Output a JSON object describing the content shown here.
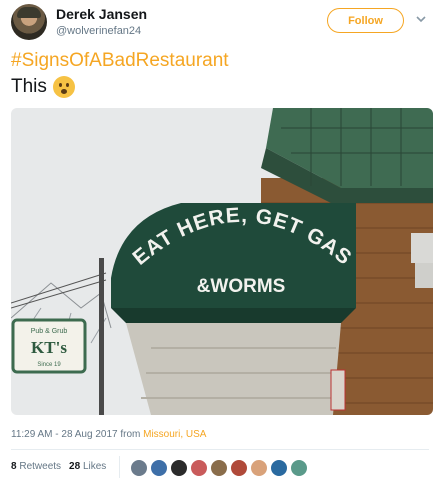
{
  "user": {
    "name": "Derek Jansen",
    "handle": "@wolverinefan24"
  },
  "follow_button": {
    "label": "Follow"
  },
  "tweet": {
    "hashtag": "#SignsOfABadRestaurant",
    "text": "This",
    "emoji_icon": "frowning-face-emoji",
    "photo": {
      "awning_line1": "EAT HERE, GET GAS",
      "awning_line2": "&WORMS",
      "side_sign_lines": [
        "Pub & Grub",
        "KT's",
        "Since 19"
      ]
    },
    "timestamp": "11:29 AM - 28 Aug 2017",
    "from_label": "from",
    "location": "Missouri, USA"
  },
  "stats": {
    "retweets_count": "8",
    "retweets_label": "Retweets",
    "likes_count": "28",
    "likes_label": "Likes",
    "liker_colors": [
      "#6b7b8c",
      "#3e6fa8",
      "#2b2b2b",
      "#c95b5b",
      "#8a6d4b",
      "#b04a3a",
      "#d9a27a",
      "#2a6aa0",
      "#5a9a8a"
    ]
  },
  "colors": {
    "accent": "#f5a623",
    "text_primary": "#14171a",
    "text_secondary": "#657786",
    "awning": "#1f4a3a"
  }
}
